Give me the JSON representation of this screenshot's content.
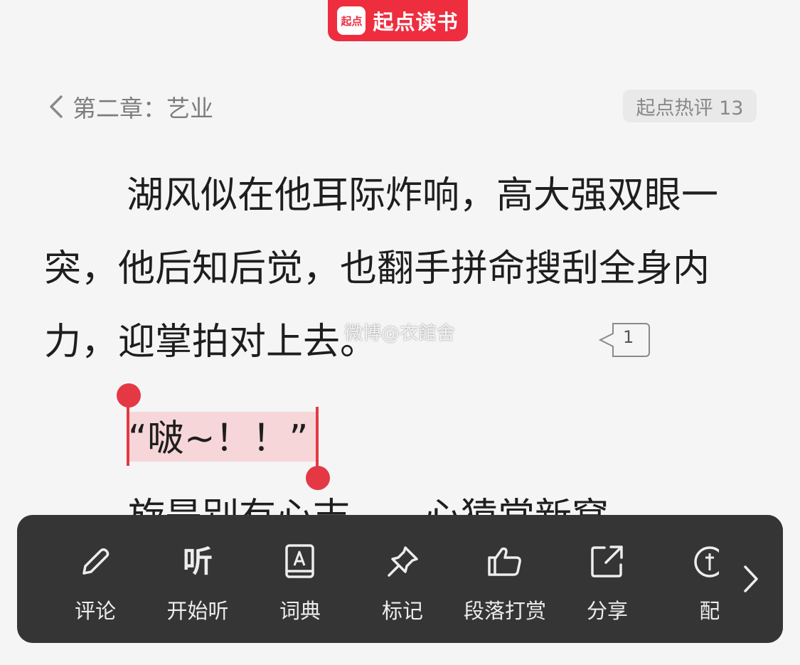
{
  "app": {
    "logo_mark": "起点",
    "logo_text": "起点读书",
    "brand_color": "#ee2d3f"
  },
  "header": {
    "chapter_title": "第二章：艺业",
    "hot_comments": "起点热评 13"
  },
  "content": {
    "paragraph1": "湖风似在他耳际炸响，高大强双眼一突，他后知后觉，也翻手拼命搜刮全身内力，迎掌拍对上去。",
    "paragraph_comment_count": "1",
    "selected_text": "“啵~！！”",
    "next_paragraph_partial": "旋是别有心志……心猿常新窝"
  },
  "watermark": "微博@衣館舍",
  "toolbar": {
    "items": [
      {
        "label": "评论",
        "icon": "pencil-icon"
      },
      {
        "label": "开始听",
        "icon": "listen-icon",
        "glyph": "听"
      },
      {
        "label": "词典",
        "icon": "dictionary-icon"
      },
      {
        "label": "标记",
        "icon": "pin-icon"
      },
      {
        "label": "段落打赏",
        "icon": "reward-icon"
      },
      {
        "label": "分享",
        "icon": "share-icon"
      },
      {
        "label": "配",
        "icon": "dub-icon"
      }
    ],
    "more_icon": "chevron-right-icon",
    "background": "#353535"
  },
  "colors": {
    "selection_handle": "#e53845",
    "selection_bg": "#f6d6d8"
  }
}
